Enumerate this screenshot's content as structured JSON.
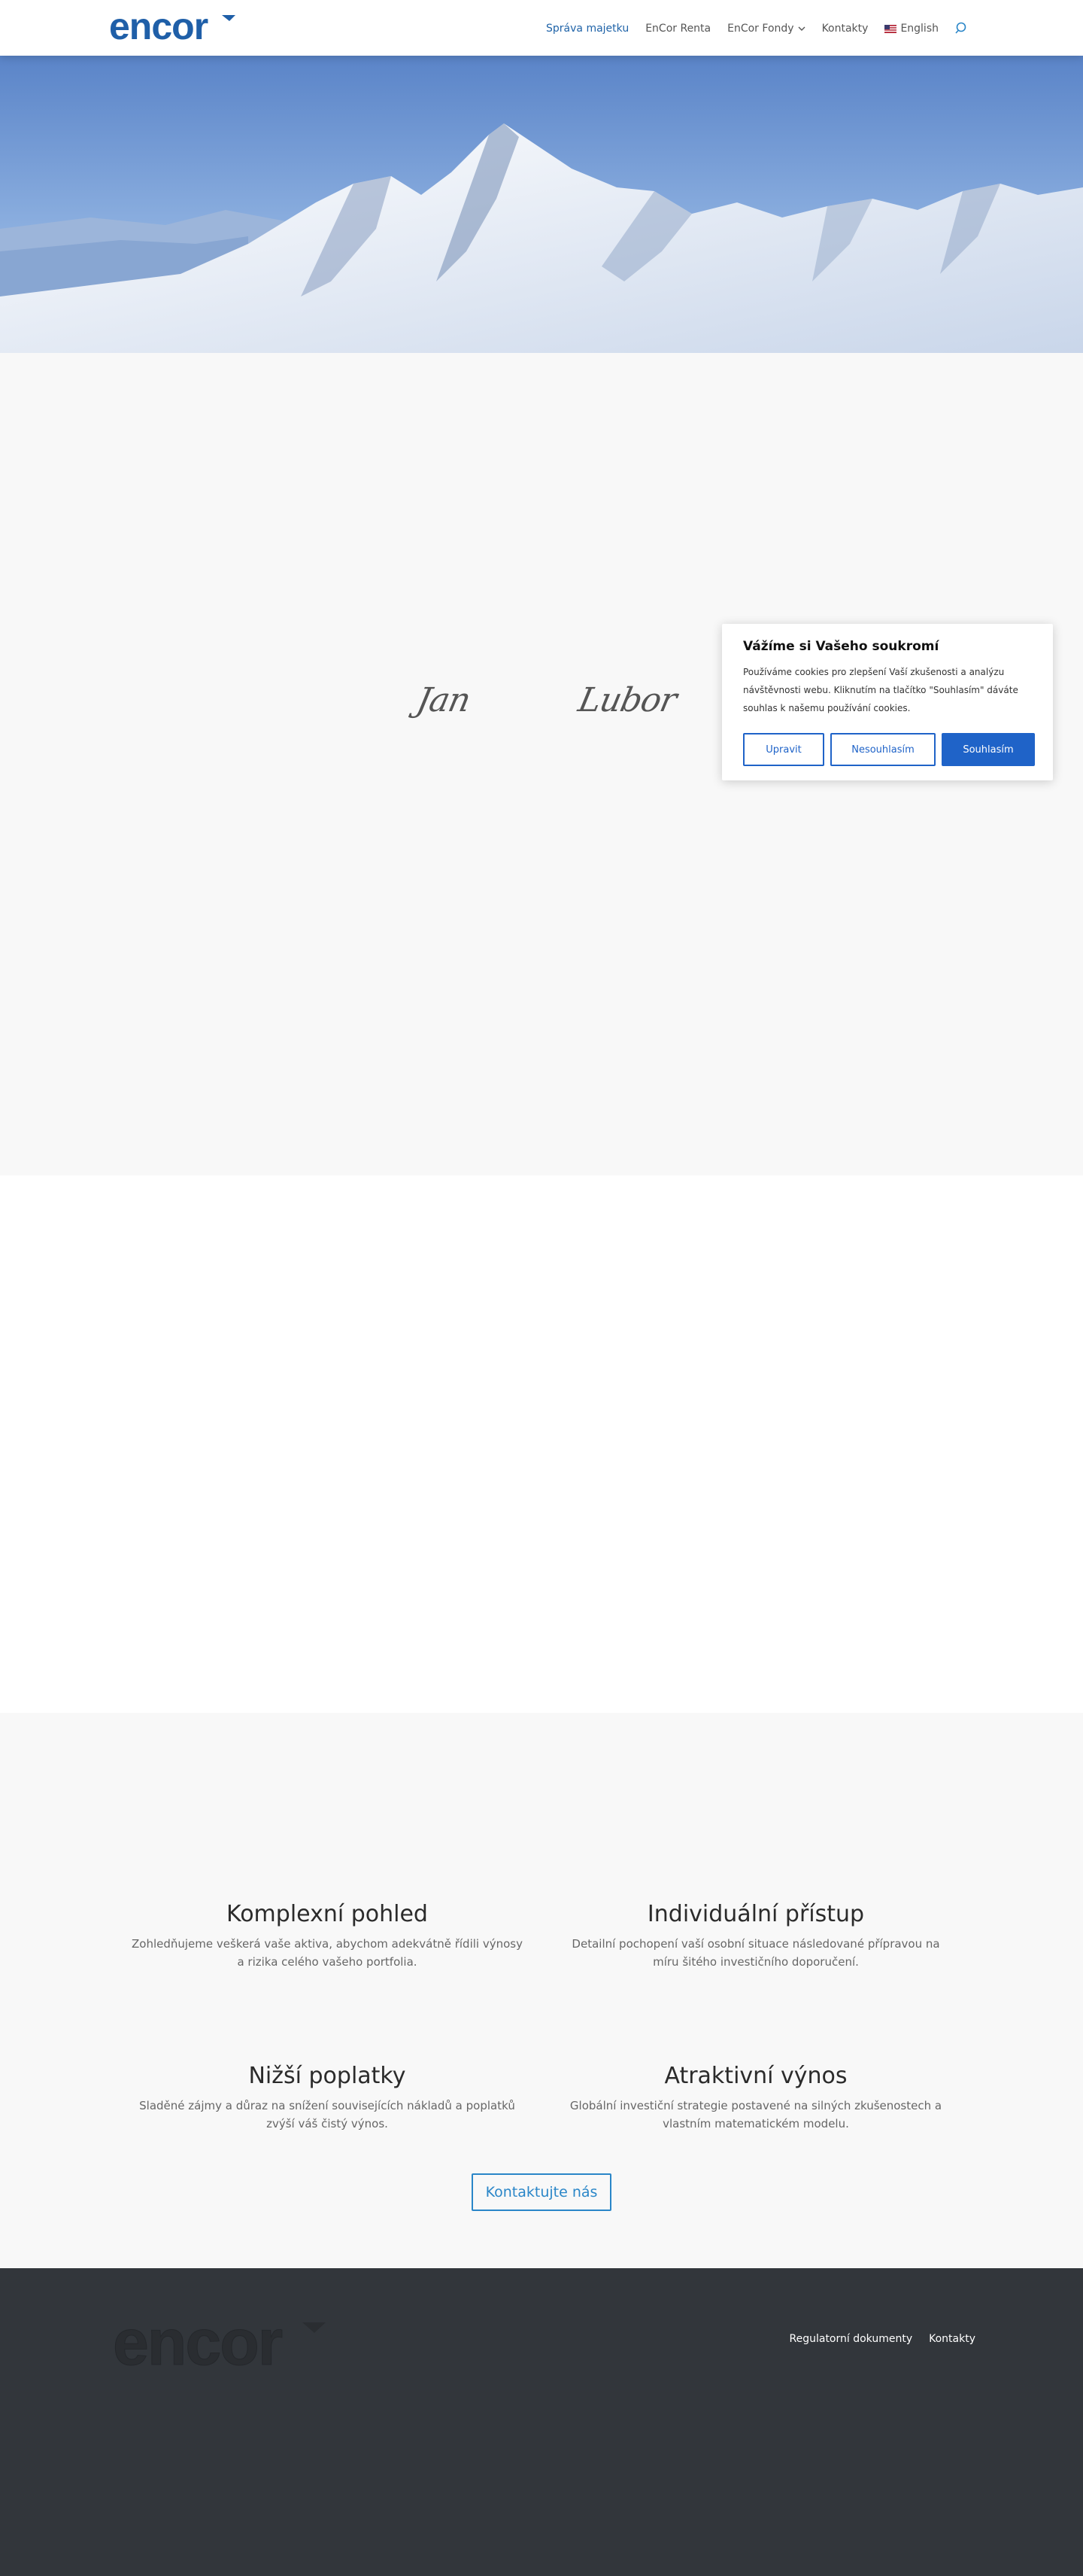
{
  "header": {
    "logo_alt": "encor",
    "nav": [
      {
        "label": "Správa majetku",
        "active": true
      },
      {
        "label": "EnCor Renta"
      },
      {
        "label": "EnCor Fondy"
      },
      {
        "label": "Kontakty"
      },
      {
        "label": "English"
      }
    ]
  },
  "signatures": [
    "Jan",
    "Lubor"
  ],
  "features": [
    {
      "title": "Komplexní pohled",
      "text": "Zohledňujeme veškerá vaše aktiva, abychom adekvátně řídili výnosy a rizika celého vašeho portfolia."
    },
    {
      "title": "Individuální přístup",
      "text": "Detailní pochopení vaší osobní situace následované přípravou na míru šitého investičního doporučení."
    },
    {
      "title": "Nižší poplatky",
      "text": "Sladěné zájmy a důraz na snížení souvisejících nákladů a poplatků zvýší váš čistý výnos."
    },
    {
      "title": "Atraktivní výnos",
      "text": "Globální investiční strategie postavené na silných zkušenostech a vlastním matematickém modelu."
    }
  ],
  "contact_button": "Kontaktujte nás",
  "footer": {
    "links": [
      "Regulatorní dokumenty",
      "Kontakty"
    ]
  },
  "cookie": {
    "title": "Vážíme si Vašeho soukromí",
    "text": "Používáme cookies pro zlepšení Vaší zkušenosti a analýzu návštěvnosti webu. Kliknutím na tlačítko \"Souhlasím\" dáváte souhlas k našemu používání cookies.",
    "buttons": {
      "customize": "Upravit",
      "reject": "Nesouhlasím",
      "accept": "Souhlasím"
    }
  },
  "colors": {
    "brand_blue": "#1f63a8",
    "accent": "#2a86c8",
    "footer_bg": "#32363b"
  }
}
